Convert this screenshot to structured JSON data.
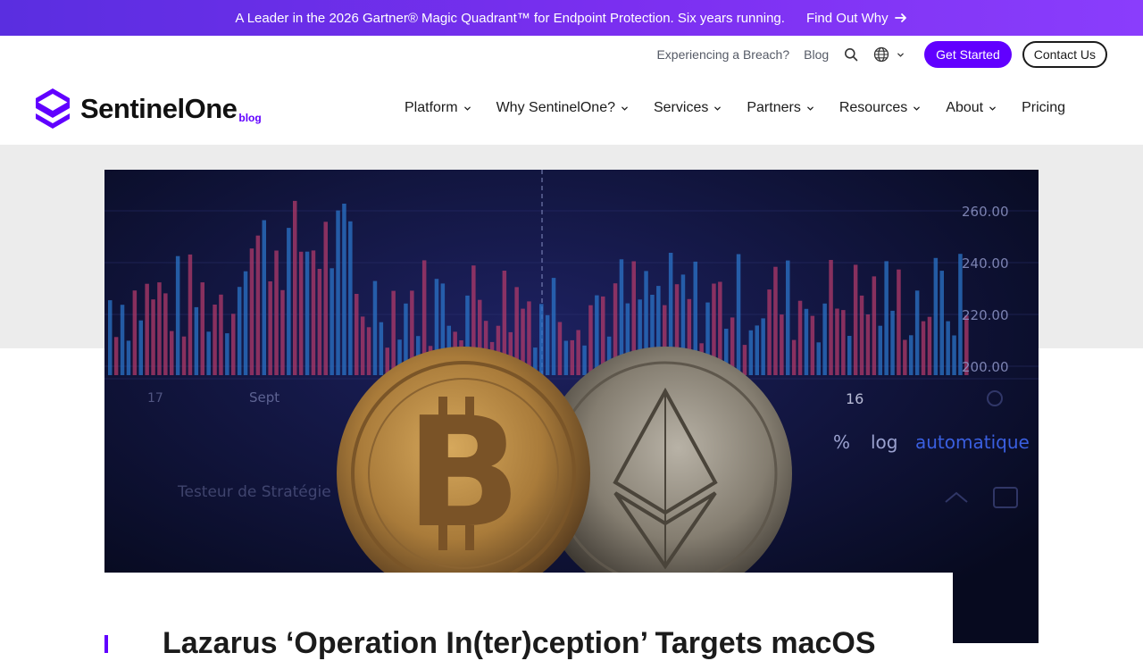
{
  "banner": {
    "text": "A Leader in the 2026 Gartner® Magic Quadrant™ for Endpoint Protection. Six years running.",
    "cta": "Find Out Why",
    "icon": "arrow-right-icon"
  },
  "utility": {
    "breach": "Experiencing a Breach?",
    "blog": "Blog",
    "search_icon": "search-icon",
    "language_icon": "globe-icon",
    "get_started": "Get Started",
    "contact": "Contact Us"
  },
  "logo": {
    "wordmark": "SentinelOne",
    "suffix": "blog"
  },
  "nav": {
    "items": [
      {
        "label": "Platform",
        "has_dropdown": true
      },
      {
        "label": "Why SentinelOne?",
        "has_dropdown": true
      },
      {
        "label": "Services",
        "has_dropdown": true
      },
      {
        "label": "Partners",
        "has_dropdown": true
      },
      {
        "label": "Resources",
        "has_dropdown": true
      },
      {
        "label": "About",
        "has_dropdown": true
      },
      {
        "label": "Pricing",
        "has_dropdown": false
      }
    ]
  },
  "hero": {
    "price_labels": [
      "260.00",
      "240.00",
      "220.00",
      "200.00"
    ],
    "date_labels": [
      "17",
      "Sept",
      "16"
    ],
    "toolbar": [
      "%",
      "log",
      "automatique"
    ],
    "strategy_label": "Testeur de Stratégie"
  },
  "article": {
    "title": "Lazarus ‘Operation In(ter)ception’ Targets macOS"
  },
  "colors": {
    "brand": "#6100ff",
    "banner_start": "#5a2ee0",
    "banner_end": "#8a3dfc",
    "band": "#ececec"
  }
}
